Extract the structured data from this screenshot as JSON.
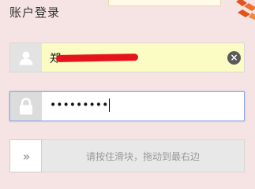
{
  "header": {
    "title": "账户登录"
  },
  "username": {
    "value": "郑",
    "icon": "user-icon",
    "clear_icon": "clear-icon",
    "clear_glyph": "×",
    "redaction_color": "#e5141c"
  },
  "password": {
    "masked_value": "•••••••••",
    "icon": "lock-icon"
  },
  "slider": {
    "handle_glyph": "»",
    "hint": "请按住滑块，拖动到最右边"
  },
  "colors": {
    "background": "#f6e3e3",
    "autofill": "#fbfcc4",
    "focus_border": "#8da8e6"
  }
}
